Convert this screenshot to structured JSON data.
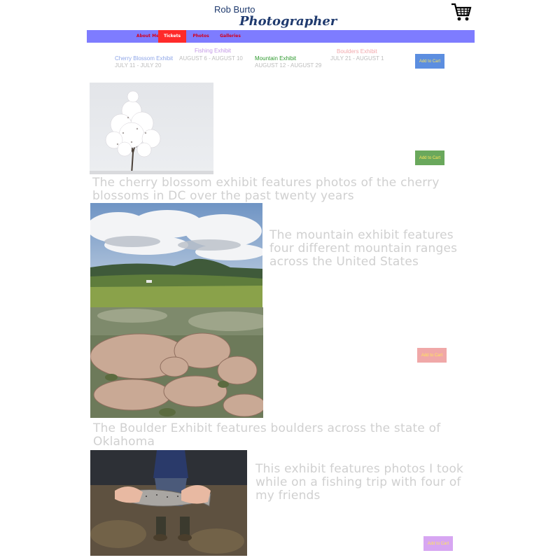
{
  "header": {
    "name": "Rob Burto",
    "title": "Photographer",
    "cart_icon": "shopping-cart-icon"
  },
  "nav": {
    "items": [
      {
        "label": "About Me"
      },
      {
        "label": "Tickets",
        "active": true
      },
      {
        "label": "Photos"
      },
      {
        "label": "Galleries"
      }
    ],
    "bar_color": "#7e7cff",
    "active_color": "#ff2a2a"
  },
  "exhibits": [
    {
      "name": "Cherry Blossom Exhibit",
      "dates": "JULY 11 - JULY 20",
      "color": "#8fa6e8"
    },
    {
      "name": "Fishing Exhibit",
      "dates": "AUGUST 6 - AUGUST 10",
      "color": "#c49ae6"
    },
    {
      "name": "Mountain Exhibit",
      "dates": "AUGUST 12 - AUGUST 29",
      "color": "#2e9a2e"
    },
    {
      "name": "Boulders Exhibit",
      "dates": "JULY 21 - AUGUST 1",
      "color": "#f2a9ad"
    }
  ],
  "buttons": {
    "add_to_cart": "Add to Cart",
    "colors": [
      "#5c8ee0",
      "#6aa85c",
      "#f0a8a8",
      "#d7a6f2"
    ]
  },
  "descriptions": {
    "cherry": "The cherry blossom exhibit features photos of the cherry blossoms in DC over the past twenty years",
    "mountain": "The mountain exhibit features four different mountain ranges across the United States",
    "boulder": "The Boulder Exhibit features boulders across the state of Oklahoma",
    "fishing": "This exhibit features photos I took while on a fishing trip with four of my friends"
  }
}
